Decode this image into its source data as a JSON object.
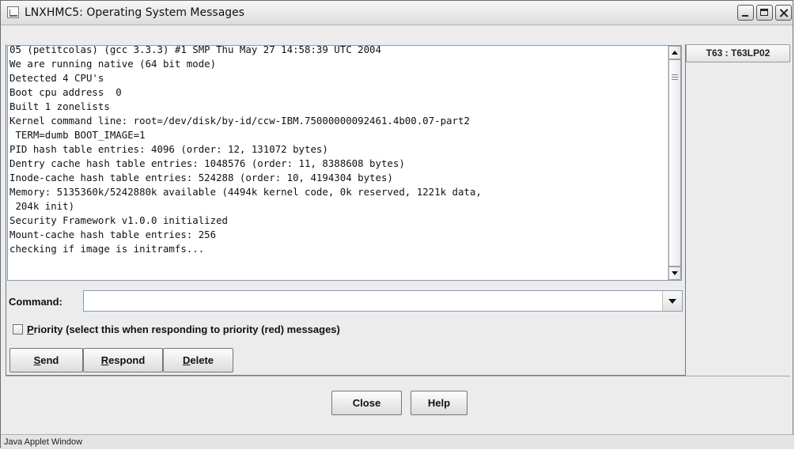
{
  "window": {
    "title": "LNXHMC5: Operating System Messages",
    "controls": [
      "minimize",
      "maximize",
      "close"
    ]
  },
  "tab": {
    "label": "T63 : T63LP02"
  },
  "log": {
    "lines": [
      "05 (petitcolas) (gcc 3.3.3) #1 SMP Thu May 27 14:58:39 UTC 2004",
      "We are running native (64 bit mode)",
      "Detected 4 CPU's",
      "Boot cpu address  0",
      "Built 1 zonelists",
      "Kernel command line: root=/dev/disk/by-id/ccw-IBM.75000000092461.4b00.07-part2",
      " TERM=dumb BOOT_IMAGE=1",
      "PID hash table entries: 4096 (order: 12, 131072 bytes)",
      "Dentry cache hash table entries: 1048576 (order: 11, 8388608 bytes)",
      "Inode-cache hash table entries: 524288 (order: 10, 4194304 bytes)",
      "Memory: 5135360k/5242880k available (4494k kernel code, 0k reserved, 1221k data,",
      " 204k init)",
      "Security Framework v1.0.0 initialized",
      "Mount-cache hash table entries: 256",
      "checking if image is initramfs..."
    ],
    "scroll_position": 1.0
  },
  "command": {
    "label": "Command:",
    "value": ""
  },
  "priority": {
    "label_first": "P",
    "label_rest": "riority (select this when responding to priority (red) messages)",
    "checked": false
  },
  "actions": {
    "send": {
      "mnemonic": "S",
      "rest": "end"
    },
    "respond": {
      "mnemonic": "R",
      "rest": "espond"
    },
    "delete": {
      "mnemonic": "D",
      "rest": "elete"
    }
  },
  "dialog_buttons": {
    "close": "Close",
    "help": "Help"
  },
  "status_bar": {
    "text": "Java Applet Window"
  }
}
